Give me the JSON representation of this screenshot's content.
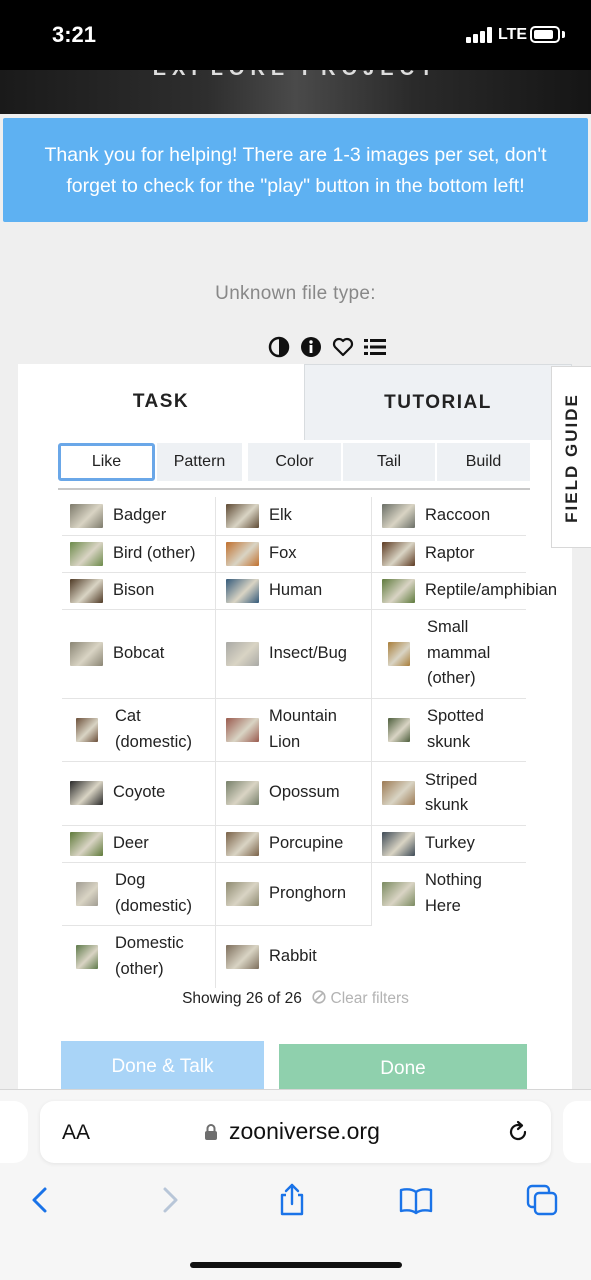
{
  "status_bar": {
    "time": "3:21",
    "network": "LTE"
  },
  "project_header": {
    "text": "EXPLORE PROJECT"
  },
  "banner": {
    "line1": "Thank you for helping! There are 1-3 images per set, don't",
    "line2": "forget to check for the \"play\" button in the bottom left!"
  },
  "subject": {
    "unknown_text": "Unknown file type:"
  },
  "subject_icons": [
    "contrast-icon",
    "info-icon",
    "heart-icon",
    "list-icon"
  ],
  "tabs": {
    "task": "TASK",
    "tutorial": "TUTORIAL"
  },
  "field_guide": "FIELD GUIDE",
  "filters": [
    "Like",
    "Pattern",
    "Color",
    "Tail",
    "Build"
  ],
  "choices": [
    {
      "label": "Badger",
      "color": "#7d7a6b"
    },
    {
      "label": "Elk",
      "color": "#5e4a34"
    },
    {
      "label": "Raccoon",
      "color": "#6a6e66"
    },
    {
      "label": "Bird (other)",
      "color": "#6c8a4a"
    },
    {
      "label": "Fox",
      "color": "#c0702e"
    },
    {
      "label": "Raptor",
      "color": "#5d3a22"
    },
    {
      "label": "Bison",
      "color": "#4f3a26"
    },
    {
      "label": "Human",
      "color": "#345a7a"
    },
    {
      "label": "Reptile/amphibian",
      "color": "#5e7a3c"
    },
    {
      "label": "Bobcat",
      "color": "#8a8574"
    },
    {
      "label": "Insect/Bug",
      "color": "#a9a9a5"
    },
    {
      "label": "Small mammal (other)",
      "color": "#a87e3a"
    },
    {
      "label": "Cat (domestic)",
      "color": "#6b4f3a"
    },
    {
      "label": "Mountain Lion",
      "color": "#9a5a4e"
    },
    {
      "label": "Spotted skunk",
      "color": "#4d5e3c"
    },
    {
      "label": "Coyote",
      "color": "#2a2a2a"
    },
    {
      "label": "Opossum",
      "color": "#77806a"
    },
    {
      "label": "Striped skunk",
      "color": "#9c7a54"
    },
    {
      "label": "Deer",
      "color": "#5f7a3a"
    },
    {
      "label": "Porcupine",
      "color": "#7a6248"
    },
    {
      "label": "Turkey",
      "color": "#3e4a56"
    },
    {
      "label": "Dog (domestic)",
      "color": "#a09c92"
    },
    {
      "label": "Pronghorn",
      "color": "#8e8a70"
    },
    {
      "label": "Nothing Here",
      "color": "#7a8a60"
    },
    {
      "label": "Domestic (other)",
      "color": "#5e7a4a"
    },
    {
      "label": "Rabbit",
      "color": "#7d6e5c"
    }
  ],
  "showing": {
    "text": "Showing 26 of 26",
    "clear": "Clear filters"
  },
  "buttons": {
    "done_talk": "Done & Talk",
    "done": "Done"
  },
  "safari": {
    "aa": "AA",
    "url": "zooniverse.org"
  },
  "colors": {
    "banner": "#5eb1f2",
    "done_talk": "#a9d4f7",
    "done": "#8fd0ad",
    "ios_blue": "#1a73e8"
  }
}
